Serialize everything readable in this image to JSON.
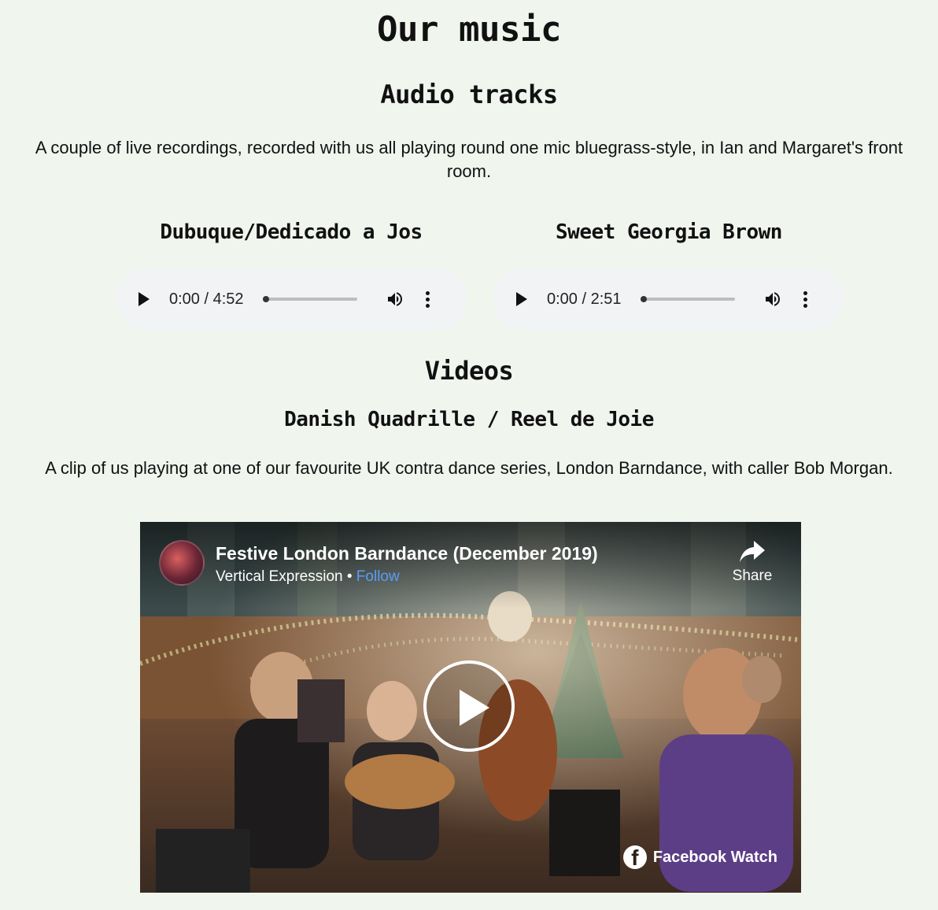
{
  "page": {
    "title": "Our music"
  },
  "audio": {
    "heading": "Audio tracks",
    "description": "A couple of live recordings, recorded with us all playing round one mic bluegrass-style, in Ian and Margaret's front room.",
    "tracks": [
      {
        "title": "Dubuque/Dedicado a Jos",
        "time": "0:00 / 4:52",
        "progress": 0
      },
      {
        "title": "Sweet Georgia Brown",
        "time": "0:00 / 2:51",
        "progress": 0
      }
    ]
  },
  "videos": {
    "heading": "Videos",
    "items": [
      {
        "title": "Danish Quadrille / Reel de Joie",
        "description": "A clip of us playing at one of our favourite UK contra dance series, London Barndance, with caller Bob Morgan.",
        "embed": {
          "video_title": "Festive London Barndance (December 2019)",
          "channel": "Vertical Expression",
          "separator": "•",
          "follow_label": "Follow",
          "share_label": "Share",
          "brand_label": "Facebook Watch"
        }
      }
    ]
  },
  "icons": {
    "play": "play-icon",
    "volume": "volume-icon",
    "menu": "more-vertical-icon",
    "share": "share-arrow-icon",
    "facebook": "facebook-icon"
  },
  "colors": {
    "background": "#f0f5ee",
    "player_background": "#f1f3f4",
    "follow_link": "#5b9cf5"
  }
}
